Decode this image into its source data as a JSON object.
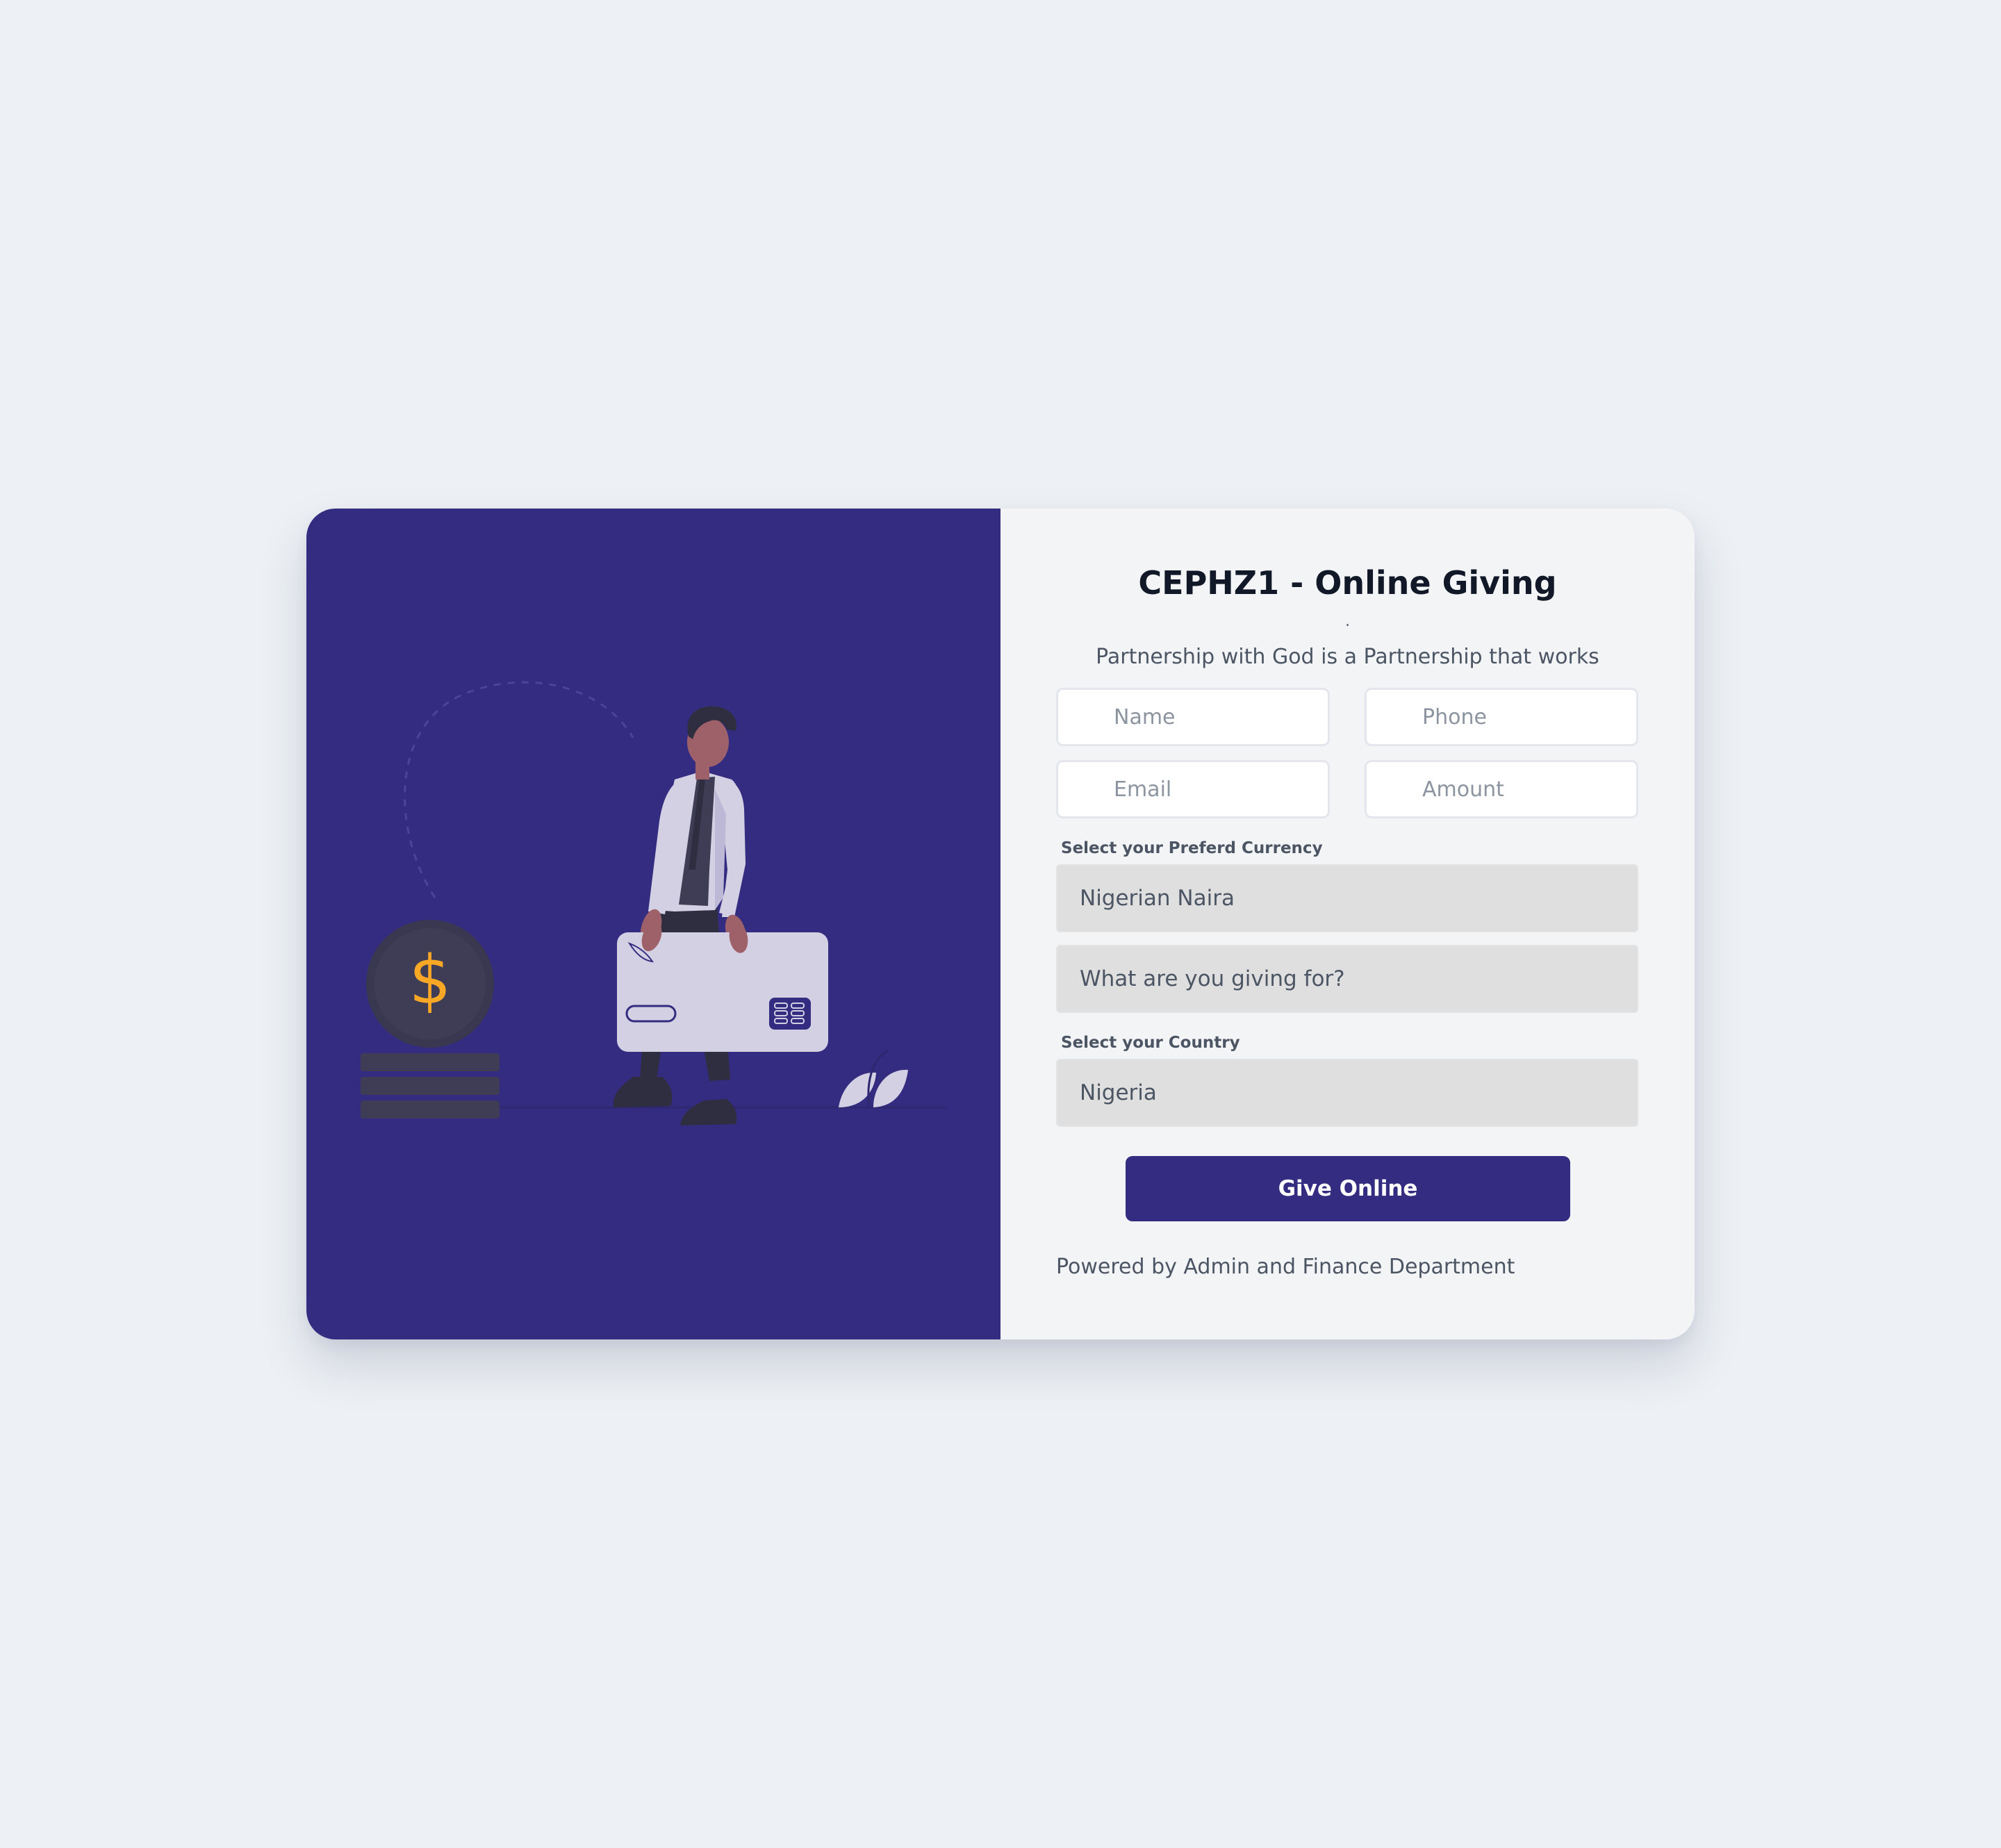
{
  "page": {
    "title": "CEPHZ1 - Online Giving",
    "separator": ".",
    "subtitle": "Partnership with God is a Partnership that works"
  },
  "form": {
    "name_placeholder": "Name",
    "phone_placeholder": "Phone",
    "email_placeholder": "Email",
    "amount_placeholder": "Amount",
    "currency_label": "Select your Preferd Currency",
    "currency_value": "Nigerian Naira",
    "purpose_value": "What are you giving for?",
    "country_label": "Select your Country",
    "country_value": "Nigeria",
    "submit_label": "Give Online"
  },
  "footer": {
    "text": "Powered by Admin and Finance Department"
  },
  "illustration": {
    "coin_symbol": "$",
    "icons": [
      "coin-icon",
      "coin-stack-icon",
      "credit-card-icon",
      "person-illustration",
      "leaf-icon"
    ]
  },
  "colors": {
    "brand": "#332c80",
    "page_background": "#edf1f5",
    "coin_accent": "#f9a826",
    "card": "#d3d0e3"
  }
}
